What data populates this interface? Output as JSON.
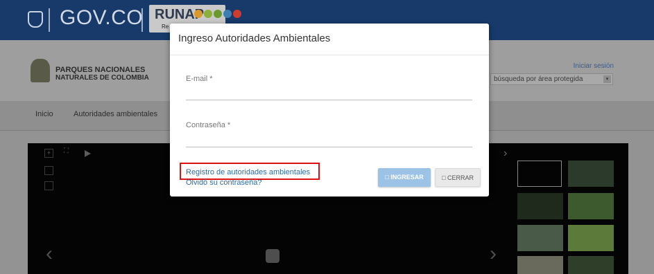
{
  "topbar": {
    "govco_label": "GOV.CO",
    "runap_label": "RUNAP",
    "runap_sub": "Re",
    "runap_dot_colors": [
      "#d99a2b",
      "#8cae3b",
      "#6a9a2e",
      "#3c7fb0",
      "#cf3b2e"
    ]
  },
  "header": {
    "org_line1": "PARQUES NACIONALES",
    "org_line2": "NATURALES DE COLOMBIA",
    "login_link": "Iniciar sesión",
    "area_select_value": "búsqueda por área protegida"
  },
  "nav": {
    "items": [
      "Inicio",
      "Autoridades ambientales"
    ]
  },
  "gallery": {
    "prev_glyph": "‹",
    "next_glyph": "›",
    "plus_glyph": "+",
    "expand_glyph": "⛶",
    "thumb_colors": [
      "#2b3a2a",
      "#1f2a1c",
      "#3c5a2e",
      "#4a5a48",
      "#5c7a3a",
      "#6a6a5c",
      "#2e3e28",
      "#3b4d36"
    ]
  },
  "modal": {
    "title": "Ingreso Autoridades Ambientales",
    "email_label": "E-mail *",
    "email_value": "",
    "password_label": "Contraseña *",
    "password_value": "",
    "register_link": "Registro de autoridades ambientales",
    "forgot_link": "Olvidó su contraseña?",
    "ingresar_label": "□ INGRESAR",
    "cerrar_label": "□ CERRAR"
  },
  "colors": {
    "highlight": "#e01010",
    "link": "#2d6aa8",
    "primary_button": "#9cc3e6"
  }
}
